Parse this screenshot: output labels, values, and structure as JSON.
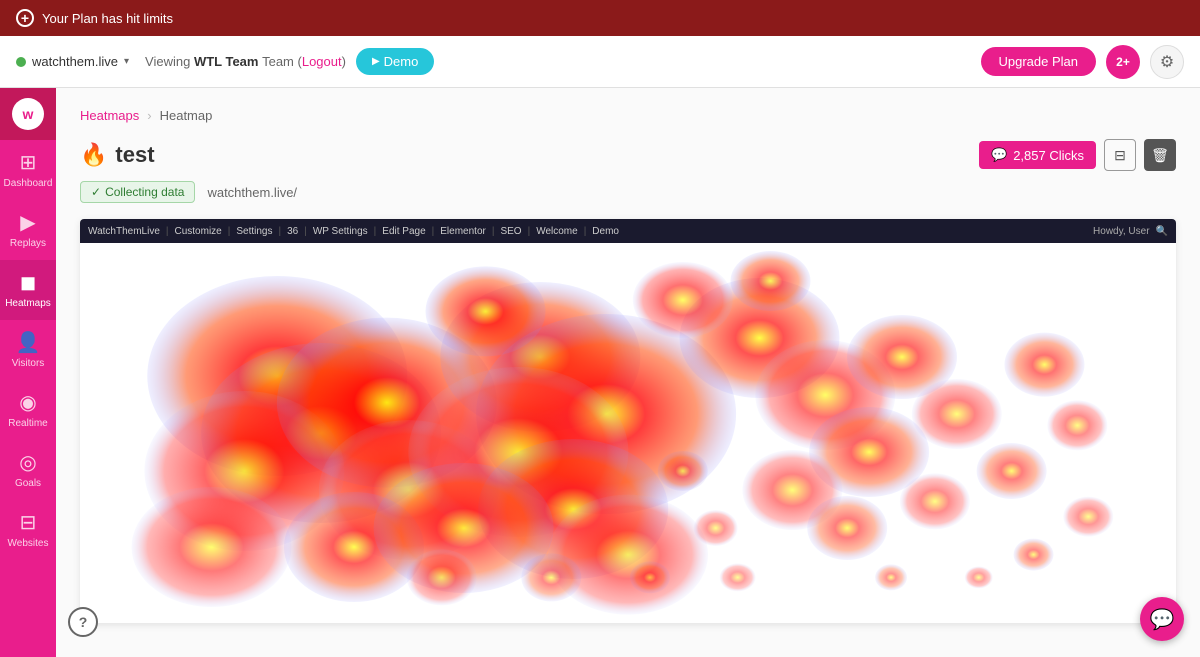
{
  "banner": {
    "text": "Your Plan has hit limits"
  },
  "header": {
    "site": "watchthem.live",
    "site_dot_color": "#4CAF50",
    "viewing_prefix": "Viewing",
    "team_name": "WTL Team",
    "team_suffix": "Team",
    "logout_label": "Logout",
    "demo_label": "Demo",
    "upgrade_label": "Upgrade Plan"
  },
  "sidebar": {
    "items": [
      {
        "label": "Dashboard",
        "icon": "⊞",
        "id": "dashboard"
      },
      {
        "label": "Replays",
        "icon": "▶",
        "id": "replays"
      },
      {
        "label": "Heatmaps",
        "icon": "🔥",
        "id": "heatmaps",
        "active": true
      },
      {
        "label": "Visitors",
        "icon": "👤",
        "id": "visitors"
      },
      {
        "label": "Realtime",
        "icon": "⊙",
        "id": "realtime"
      },
      {
        "label": "Goals",
        "icon": "◎",
        "id": "goals"
      },
      {
        "label": "Websites",
        "icon": "⊟",
        "id": "websites"
      }
    ]
  },
  "breadcrumb": {
    "parent": "Heatmaps",
    "current": "Heatmap"
  },
  "page": {
    "title": "test",
    "flame_icon": "🔥",
    "status": "Collecting data",
    "site_url": "watchthem.live/",
    "clicks_label": "2,857 Clicks",
    "clicks_icon": "💬"
  },
  "toolbar": {
    "items": [
      "WatchThemLive",
      "Customize",
      "Settings",
      "36",
      "WP Settings",
      "Edit Page",
      "Elementor",
      "SEO",
      "Welcome",
      "Demo"
    ]
  },
  "help_label": "?",
  "chat_icon": "💬"
}
